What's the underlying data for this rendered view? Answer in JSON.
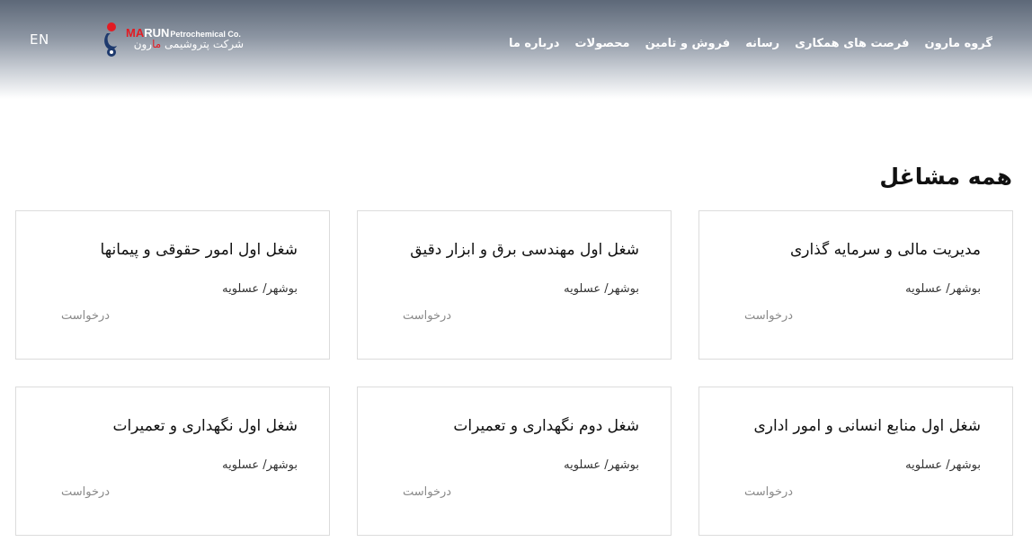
{
  "header": {
    "lang_toggle": "EN",
    "logo": {
      "brand_ma": "MA",
      "brand_run": "RUN",
      "brand_co": "Petrochemical Co.",
      "fa_prefix": "شرکت پتروشیمی ",
      "fa_red": "ما",
      "fa_suffix": "رون"
    },
    "nav": [
      {
        "label": "درباره ما"
      },
      {
        "label": "محصولات"
      },
      {
        "label": "فروش و تامین"
      },
      {
        "label": "رسانه"
      },
      {
        "label": "فرصت های همکاری"
      },
      {
        "label": "گروه مارون"
      }
    ]
  },
  "main": {
    "title": "همه مشاغل",
    "jobs": [
      {
        "title": "مدیریت مالی و سرمایه گذاری",
        "location": "بوشهر/ عسلویه",
        "apply": "درخواست"
      },
      {
        "title": "شغل اول مهندسی برق و ابزار دقیق",
        "location": "بوشهر/ عسلویه",
        "apply": "درخواست"
      },
      {
        "title": "شغل اول امور حقوقی و پیمانها",
        "location": "بوشهر/ عسلویه",
        "apply": "درخواست"
      },
      {
        "title": "شغل اول منابع انسانی و امور اداری",
        "location": "بوشهر/ عسلویه",
        "apply": "درخواست"
      },
      {
        "title": "شغل دوم نگهداری و تعمیرات",
        "location": "بوشهر/ عسلویه",
        "apply": "درخواست"
      },
      {
        "title": "شغل اول نگهداری و تعمیرات",
        "location": "بوشهر/ عسلویه",
        "apply": "درخواست"
      }
    ]
  },
  "colors": {
    "brand_red": "#e31b23",
    "brand_navy": "#1e3a6e",
    "header_top": "#5d6878",
    "card_border": "#dcdcdc",
    "apply_gray": "#8a8a8a"
  }
}
